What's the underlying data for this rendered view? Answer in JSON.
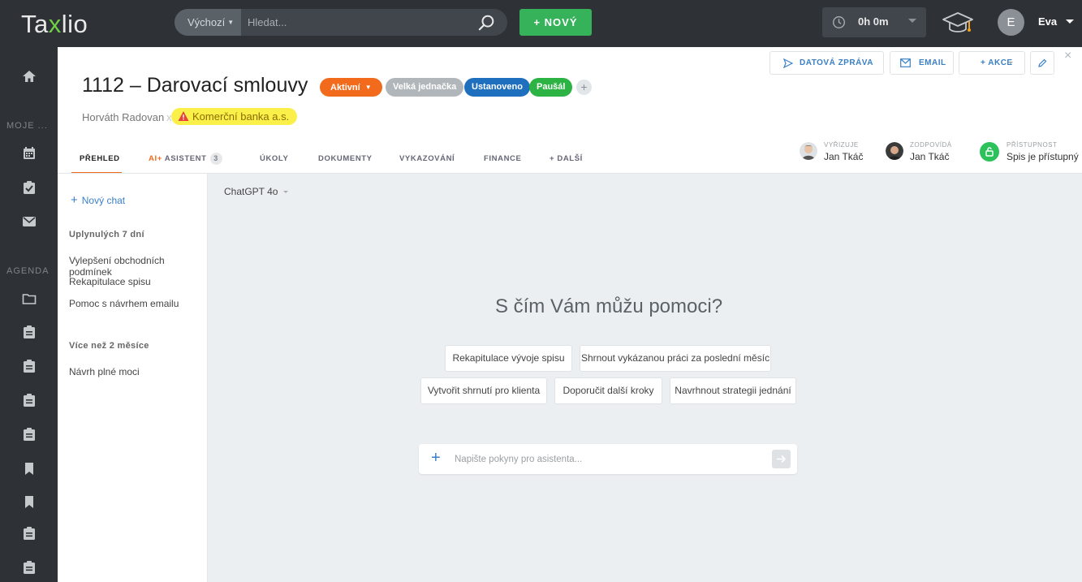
{
  "topbar": {
    "logo_pre": "Ta",
    "logo_x": "x",
    "logo_post": "lio",
    "search_scope": "Výchozí",
    "search_placeholder": "Hledat...",
    "new_button": "+ NOVÝ",
    "timer": "0h 0m",
    "user_initial": "E",
    "user_name": "Eva"
  },
  "rail": {
    "section_moje": "MOJE ...",
    "section_agenda": "AGENDA"
  },
  "header": {
    "title": "1112 – Darovací smlouvy",
    "badges": {
      "aktivni": "Aktivní",
      "velka": "Velká jednačka",
      "ustanoveno": "Ustanoveno",
      "pausal": "Paušál",
      "plus": "+"
    },
    "client": "Horváth Radovan",
    "client_remove": "x",
    "bank": "Komerční banka a.s.",
    "buttons": {
      "datova": "DATOVÁ ZPRÁVA",
      "email": "EMAIL",
      "akce": "+ AKCE"
    },
    "close": "×",
    "tabs": {
      "prehled": "PŘEHLED",
      "ai": "AI+",
      "asistent": "ASISTENT",
      "asistent_count": "3",
      "ukoly": "ÚKOLY",
      "dokumenty": "DOKUMENTY",
      "vykazovani": "VYKAZOVÁNÍ",
      "finance": "FINANCE",
      "dalsi": "+ DALŠÍ"
    },
    "people": {
      "vyrizuje_label": "VYŘIZUJE",
      "vyrizuje_name": "Jan Tkáč",
      "zodpovida_label": "ZODPOVÍDÁ",
      "zodpovida_name": "Jan Tkáč",
      "pristupnost_label": "PŘÍSTUPNOST",
      "pristupnost_value": "Spis je přístupný"
    }
  },
  "chat_sidebar": {
    "new_chat": "Nový chat",
    "group1": "Uplynulých 7 dní",
    "group1_items": [
      "Vylepšení obchodních podmínek",
      "Rekapitulace spisu",
      "Pomoc s návrhem emailu"
    ],
    "group2": "Více než 2 měsíce",
    "group2_items": [
      "Návrh plné moci"
    ]
  },
  "main": {
    "model": "ChatGPT 4o",
    "heading": "S čím Vám můžu pomoci?",
    "suggestions": [
      "Rekapitulace vývoje spisu",
      "Shrnout vykázanou práci za poslední měsíc",
      "Vytvořit shrnutí pro klienta",
      "Doporučit další kroky",
      "Navrhnout strategii jednání"
    ],
    "input_placeholder": "Napište pokyny pro asistenta..."
  },
  "colors": {
    "topbar_bg": "#2e3236",
    "accent_green": "#35b25a",
    "accent_orange": "#f26a1b",
    "accent_blue": "#3a7fc4",
    "highlight_yellow": "#fbf04a"
  }
}
